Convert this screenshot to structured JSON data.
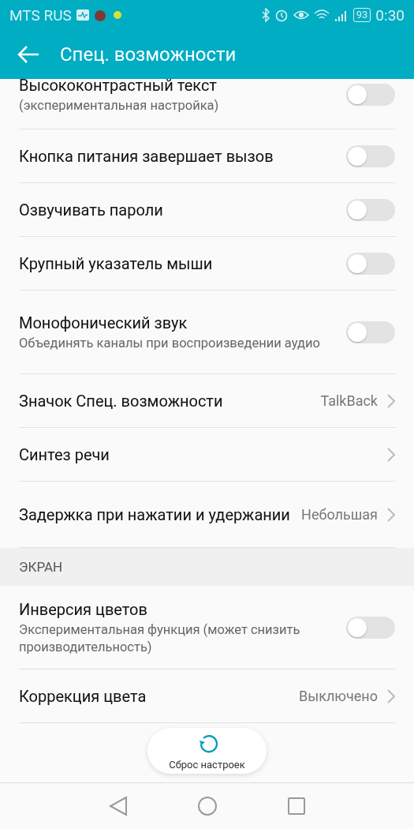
{
  "status_bar": {
    "carrier": "MTS RUS",
    "battery": "93",
    "time": "0:30"
  },
  "header": {
    "title": "Спец. возможности"
  },
  "items": [
    {
      "kind": "toggle",
      "title": "Высококонтрастный текст",
      "subtitle": "(экспериментальная настройка)",
      "on": false
    },
    {
      "kind": "toggle",
      "title": "Кнопка питания завершает вызов",
      "on": false
    },
    {
      "kind": "toggle",
      "title": "Озвучивать пароли",
      "on": false
    },
    {
      "kind": "toggle",
      "title": "Крупный указатель мыши",
      "on": false
    },
    {
      "kind": "toggle",
      "title": "Монофонический звук",
      "subtitle": "Объединять каналы при воспроизведении аудио",
      "on": false
    },
    {
      "kind": "link",
      "title": "Значок Спец. возможности",
      "value": "TalkBack"
    },
    {
      "kind": "link",
      "title": "Синтез речи"
    },
    {
      "kind": "link",
      "title": "Задержка при нажатии и удержании",
      "value": "Небольшая"
    },
    {
      "kind": "section",
      "title": "ЭКРАН"
    },
    {
      "kind": "toggle",
      "title": "Инверсия цветов",
      "subtitle": "Экспериментальная функция (может снизить производительность)",
      "on": false
    },
    {
      "kind": "link",
      "title": "Коррекция цвета",
      "value": "Выключено"
    }
  ],
  "reset_button": {
    "label": "Сброс настроек"
  }
}
